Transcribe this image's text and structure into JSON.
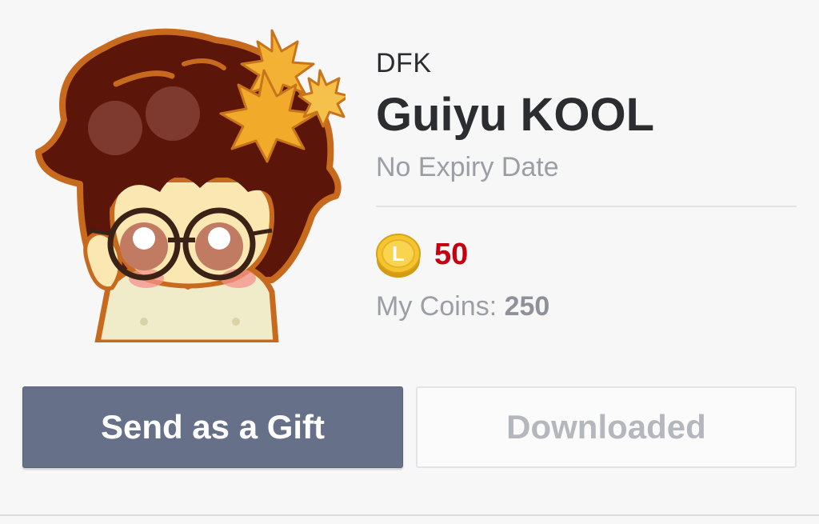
{
  "sticker": {
    "author": "DFK",
    "title": "Guiyu KOOL",
    "expiry": "No Expiry Date",
    "image_icon": "chibi-character-with-glasses-and-maple-leaves"
  },
  "price": {
    "coin_icon": "line-coin-icon",
    "value": "50",
    "color": "#c40010"
  },
  "wallet": {
    "label": "My Coins:",
    "amount": "250"
  },
  "actions": {
    "gift_label": "Send as a Gift",
    "downloaded_label": "Downloaded"
  },
  "colors": {
    "gift_button": "#667189",
    "background": "#f7f7f8"
  }
}
